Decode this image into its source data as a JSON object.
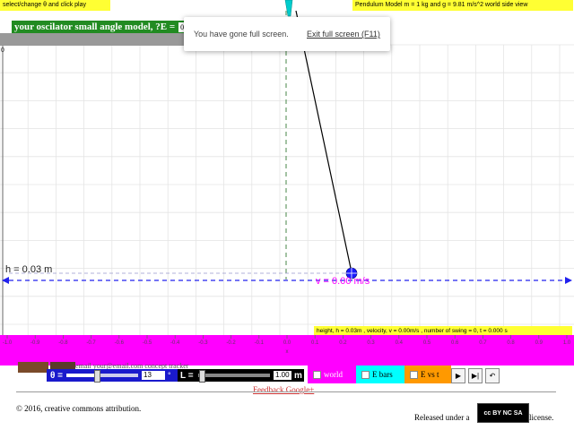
{
  "header": {
    "instruction": "select/change θ and click play",
    "model_info": "Pendulum Model m = 1 kg and g = 9.81 m/s^2 world side view",
    "model_title": "your oscilator small angle model, ?E =",
    "energy_value": "0"
  },
  "toast": {
    "message": "You have gone full screen.",
    "exit_label": "Exit full screen (F11)"
  },
  "simulation": {
    "height_label": "h = 0.03 m",
    "velocity_label": "v = 0.00 m/s",
    "status": "height, h = 0.03m , velocity, v = 0.00m/s , number of swing = 0, t = 0.000 s",
    "axis_origin_label": "0",
    "axis_ticks": [
      "-1.0",
      "-0.9",
      "-0.8",
      "-0.7",
      "-0.6",
      "-0.5",
      "-0.4",
      "-0.3",
      "-0.2",
      "-0.1",
      "0.0",
      "0.1",
      "0.2",
      "0.3",
      "0.4",
      "0.5",
      "0.6",
      "0.7",
      "0.8",
      "0.9",
      "1.0"
    ],
    "axis_unit": "x"
  },
  "controls": {
    "theta_label": "θ =",
    "theta_value": "13",
    "theta_fraction": 0.42,
    "degree_symbol": "°",
    "length_label": "L =",
    "length_value": "1.00",
    "length_fraction": 0.05,
    "length_unit": "m",
    "world_label": "world",
    "ebars_label": "E bars",
    "evst_label": "E vs t",
    "hidden_email_text": "email  your@email.com  concept  tracker"
  },
  "footer": {
    "feedback": "Feedback Google+",
    "copyright": "© 2016, creative commons attribution.",
    "released_prefix": "Released under a",
    "released_suffix": "license.",
    "cc_badge": "cc BY NC SA"
  },
  "colors": {
    "accent_magenta": "#ff00ff",
    "accent_yellow": "#ffff33",
    "accent_green": "#228b22",
    "pendulum_blue": "#1a1aff",
    "grid": "#e4e4e4"
  }
}
